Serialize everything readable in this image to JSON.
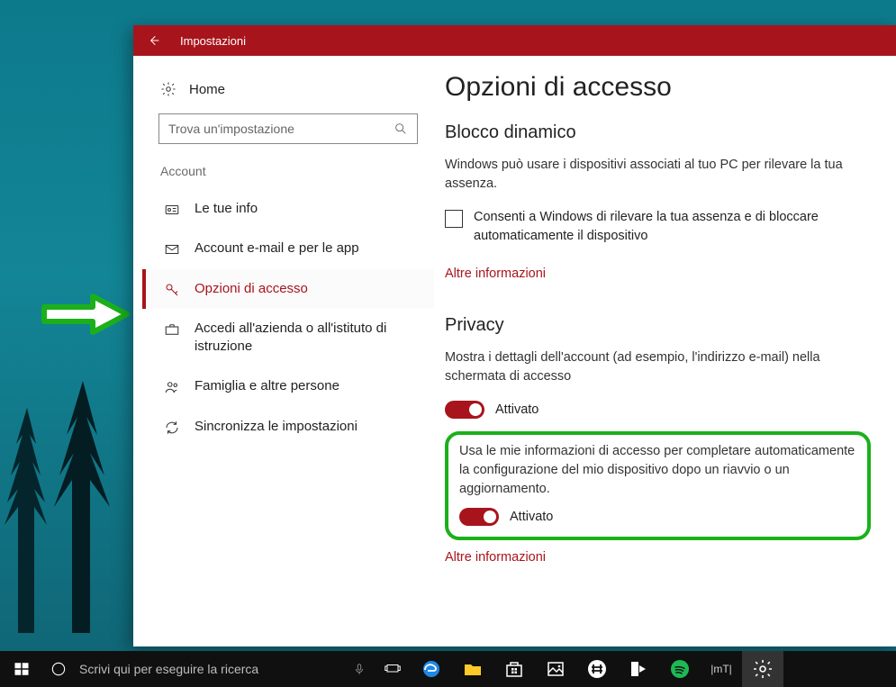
{
  "window": {
    "title": "Impostazioni",
    "home_label": "Home",
    "search_placeholder": "Trova un'impostazione",
    "group_label": "Account",
    "nav": [
      {
        "label": "Le tue info"
      },
      {
        "label": "Account e-mail e per le app"
      },
      {
        "label": "Opzioni di accesso"
      },
      {
        "label": "Accedi all'azienda o all'istituto di istruzione"
      },
      {
        "label": "Famiglia e altre persone"
      },
      {
        "label": "Sincronizza le impostazioni"
      }
    ]
  },
  "content": {
    "page_title": "Opzioni di accesso",
    "section1": {
      "heading": "Blocco dinamico",
      "description": "Windows può usare i dispositivi associati al tuo PC per rilevare la tua assenza.",
      "checkbox_label": "Consenti a Windows di rilevare la tua assenza e di bloccare automaticamente il dispositivo",
      "more_info": "Altre informazioni"
    },
    "section2": {
      "heading": "Privacy",
      "toggle1_desc": "Mostra i dettagli dell'account (ad esempio, l'indirizzo e-mail) nella schermata di accesso",
      "toggle1_state_label": "Attivato",
      "toggle2_desc": "Usa le mie informazioni di accesso per completare automaticamente la configurazione del mio dispositivo dopo un riavvio o un aggiornamento.",
      "toggle2_state_label": "Attivato",
      "more_info": "Altre informazioni"
    }
  },
  "taskbar": {
    "search_placeholder": "Scrivi qui per eseguire la ricerca",
    "mt_label": "|mT|"
  }
}
